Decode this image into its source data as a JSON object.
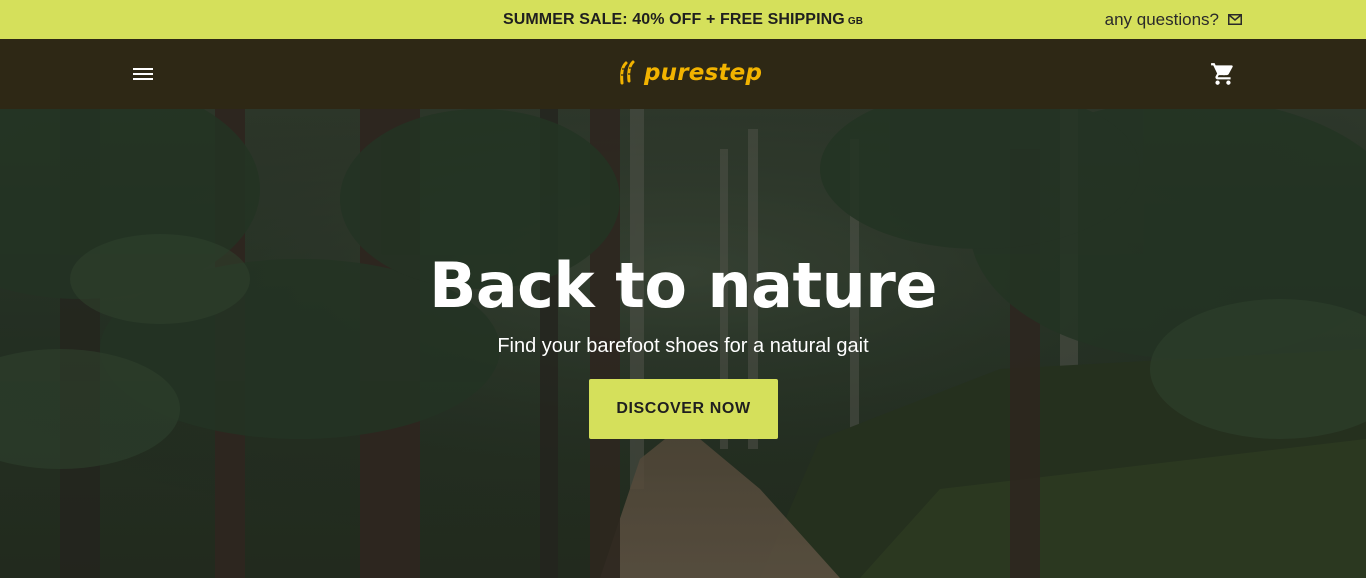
{
  "announcement": {
    "sale_text": "SUMMER SALE: 40% OFF + FREE SHIPPING",
    "country": "GB",
    "questions_label": "any questions?"
  },
  "nav": {
    "logo_text": "purestep",
    "menu_icon": "hamburger-menu-icon",
    "cart_icon": "shopping-cart-icon"
  },
  "hero": {
    "title": "Back to nature",
    "subtitle": "Find your barefoot shoes for a natural gait",
    "cta_label": "DISCOVER NOW"
  },
  "colors": {
    "accent": "#d5e05b",
    "nav_bg": "#2e2815",
    "logo": "#f2b300"
  }
}
